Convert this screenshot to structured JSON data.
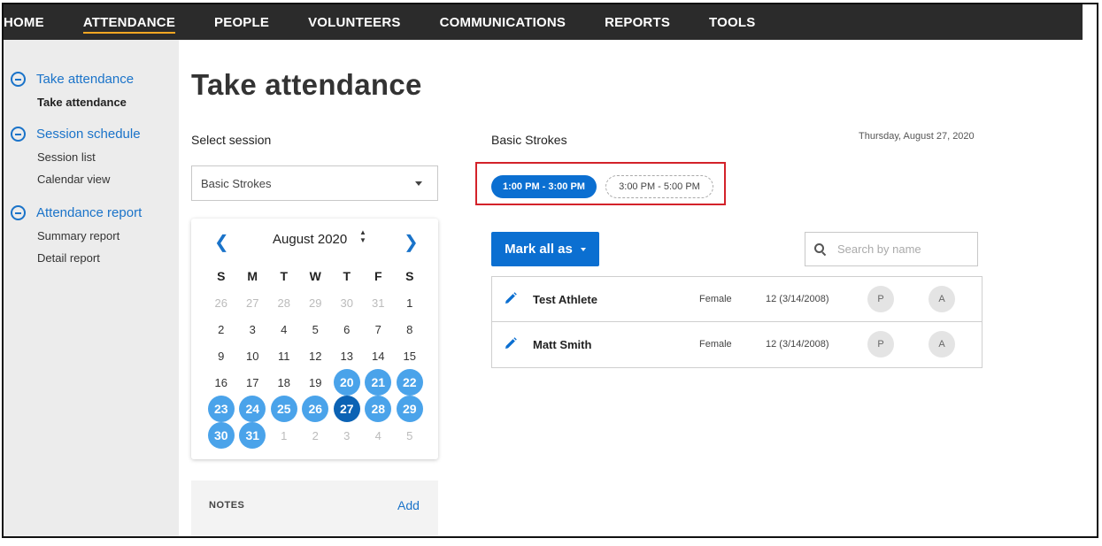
{
  "topnav": {
    "items": [
      {
        "label": "HOME",
        "active": false
      },
      {
        "label": "ATTENDANCE",
        "active": true
      },
      {
        "label": "PEOPLE",
        "active": false
      },
      {
        "label": "VOLUNTEERS",
        "active": false
      },
      {
        "label": "COMMUNICATIONS",
        "active": false
      },
      {
        "label": "REPORTS",
        "active": false
      },
      {
        "label": "TOOLS",
        "active": false
      }
    ]
  },
  "sidebar": {
    "groups": [
      {
        "title": "Take attendance",
        "items": [
          "Take attendance"
        ]
      },
      {
        "title": "Session schedule",
        "items": [
          "Session list",
          "Calendar view"
        ]
      },
      {
        "title": "Attendance report",
        "items": [
          "Summary report",
          "Detail report"
        ]
      }
    ]
  },
  "main": {
    "page_title": "Take attendance",
    "select_label": "Select session",
    "selected_session": "Basic Strokes"
  },
  "calendar": {
    "month_label": "August 2020",
    "weekday_headers": [
      "S",
      "M",
      "T",
      "W",
      "T",
      "F",
      "S"
    ],
    "weeks": [
      [
        "26",
        "27",
        "28",
        "29",
        "30",
        "31",
        "1"
      ],
      [
        "2",
        "3",
        "4",
        "5",
        "6",
        "7",
        "8"
      ],
      [
        "9",
        "10",
        "11",
        "12",
        "13",
        "14",
        "15"
      ],
      [
        "16",
        "17",
        "18",
        "19",
        "20",
        "21",
        "22"
      ],
      [
        "23",
        "24",
        "25",
        "26",
        "27",
        "28",
        "29"
      ],
      [
        "30",
        "31",
        "1",
        "2",
        "3",
        "4",
        "5"
      ]
    ],
    "selected_day": "27",
    "available_days": [
      "20",
      "21",
      "22",
      "23",
      "24",
      "25",
      "26",
      "28",
      "29",
      "30",
      "31"
    ]
  },
  "notes": {
    "label": "NOTES",
    "add_label": "Add"
  },
  "session_panel": {
    "session_name": "Basic Strokes",
    "date": "Thursday, August 27, 2020",
    "time_slots": [
      {
        "label": "1:00 PM - 3:00 PM",
        "active": true
      },
      {
        "label": "3:00 PM - 5:00 PM",
        "active": false
      }
    ],
    "mark_all_label": "Mark all as",
    "search_placeholder": "Search by name"
  },
  "roster": [
    {
      "name": "Test Athlete",
      "gender": "Female",
      "age": "12 (3/14/2008)",
      "present_label": "P",
      "absent_label": "A"
    },
    {
      "name": "Matt Smith",
      "gender": "Female",
      "age": "12 (3/14/2008)",
      "present_label": "P",
      "absent_label": "A"
    }
  ],
  "colors": {
    "accent_blue": "#0b6fd1",
    "calendar_available": "#4aa3ea",
    "calendar_selected": "#0b62b4",
    "nav_background": "#2b2b2b",
    "nav_active_underline": "#f5a623",
    "highlight_border": "#d3222a"
  },
  "icons": {
    "sidebar_group": "minus-circle-icon",
    "calendar_prev": "chevron-left-icon",
    "calendar_next": "chevron-right-icon",
    "select_caret": "caret-down-icon",
    "search": "search-icon",
    "edit": "pencil-icon"
  }
}
